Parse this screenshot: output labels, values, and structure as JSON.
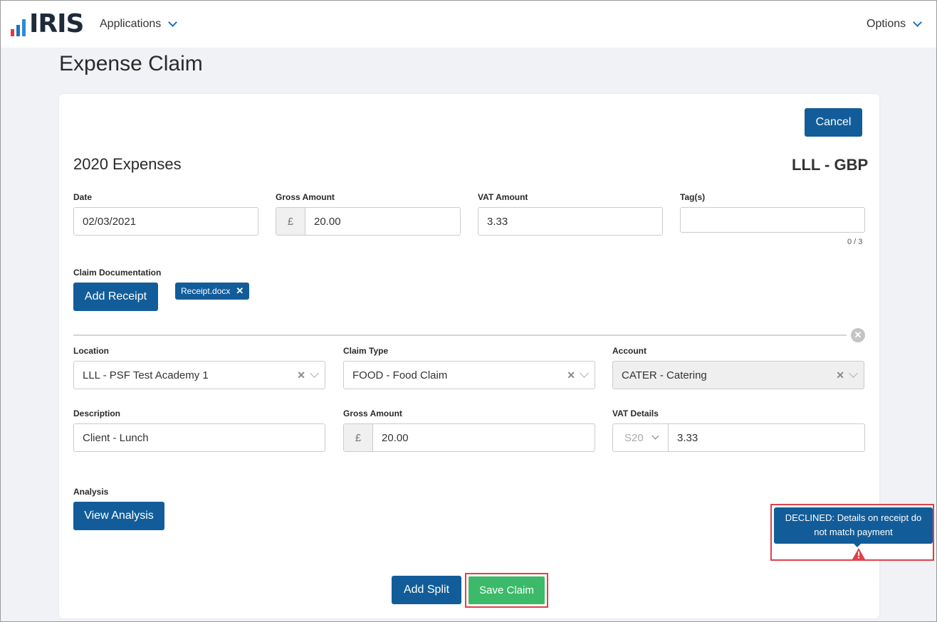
{
  "header": {
    "logo_text": "IRIS",
    "nav_applications": "Applications",
    "nav_options": "Options"
  },
  "page": {
    "title": "Expense Claim"
  },
  "actions": {
    "cancel": "Cancel",
    "add_split": "Add Split",
    "save_claim": "Save Claim"
  },
  "claim": {
    "section_title": "2020 Expenses",
    "entity_currency": "LLL - GBP",
    "date_label": "Date",
    "date_value": "02/03/2021",
    "gross_label": "Gross Amount",
    "currency_symbol": "£",
    "gross_value": "20.00",
    "vat_label": "VAT Amount",
    "vat_value": "3.33",
    "tags_label": "Tag(s)",
    "tags_value": "",
    "tags_counter": "0 / 3",
    "documentation_label": "Claim Documentation",
    "add_receipt": "Add Receipt",
    "attachment_name": "Receipt.docx"
  },
  "split": {
    "location_label": "Location",
    "location_value": "LLL - PSF Test Academy 1",
    "claim_type_label": "Claim Type",
    "claim_type_value": "FOOD - Food Claim",
    "account_label": "Account",
    "account_value": "CATER - Catering",
    "description_label": "Description",
    "description_value": "Client - Lunch",
    "gross_label": "Gross Amount",
    "currency_symbol": "£",
    "gross_value": "20.00",
    "vat_details_label": "VAT Details",
    "vat_code": "S20",
    "vat_value": "3.33",
    "analysis_label": "Analysis",
    "view_analysis": "View Analysis"
  },
  "status_tooltip": {
    "line1": "DECLINED: Details on receipt do",
    "line2": "not match payment"
  },
  "colors": {
    "primary": "#125d99",
    "success": "#3cba6a",
    "highlight": "#e0404a",
    "background": "#f0f2f5"
  }
}
